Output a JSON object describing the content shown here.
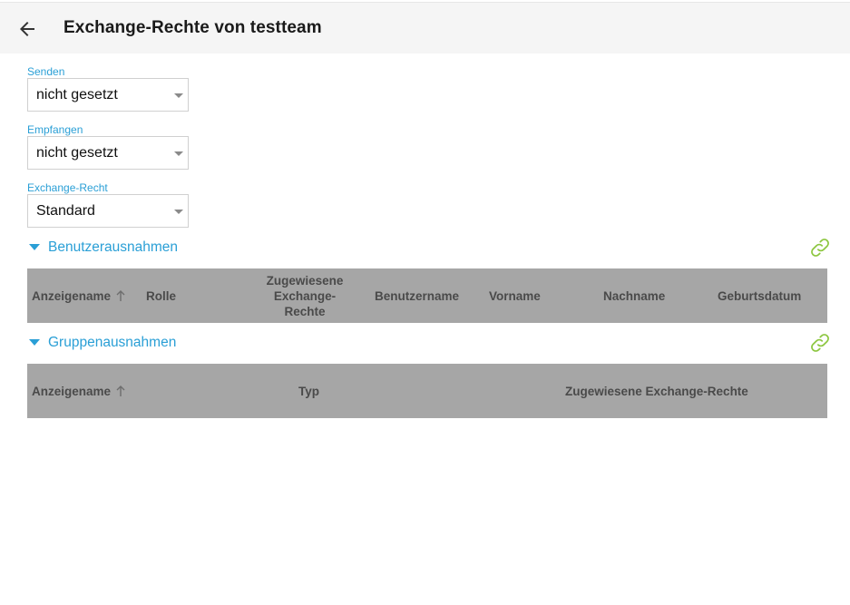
{
  "header": {
    "title": "Exchange-Rechte von testteam",
    "back_icon": "arrow-left-icon"
  },
  "fields": {
    "senden": {
      "label": "Senden",
      "value": "nicht gesetzt"
    },
    "empfangen": {
      "label": "Empfangen",
      "value": "nicht gesetzt"
    },
    "exchange_recht": {
      "label": "Exchange-Recht",
      "value": "Standard"
    }
  },
  "sections": {
    "benutzer": {
      "label": "Benutzerausnahmen",
      "columns": [
        "Anzeigename",
        "Rolle",
        "Zugewiesene Exchange-Rechte",
        "Benutzername",
        "Vorname",
        "Nachname",
        "Geburtsdatum"
      ]
    },
    "gruppen": {
      "label": "Gruppenausnahmen",
      "columns": [
        "Anzeigename",
        "Typ",
        "Zugewiesene Exchange-Rechte"
      ]
    }
  },
  "colors": {
    "accent": "#2a9fd6",
    "link_icon": "#8cc63f",
    "table_header": "#a6a6a6",
    "header_bg": "#f5f5f5"
  }
}
